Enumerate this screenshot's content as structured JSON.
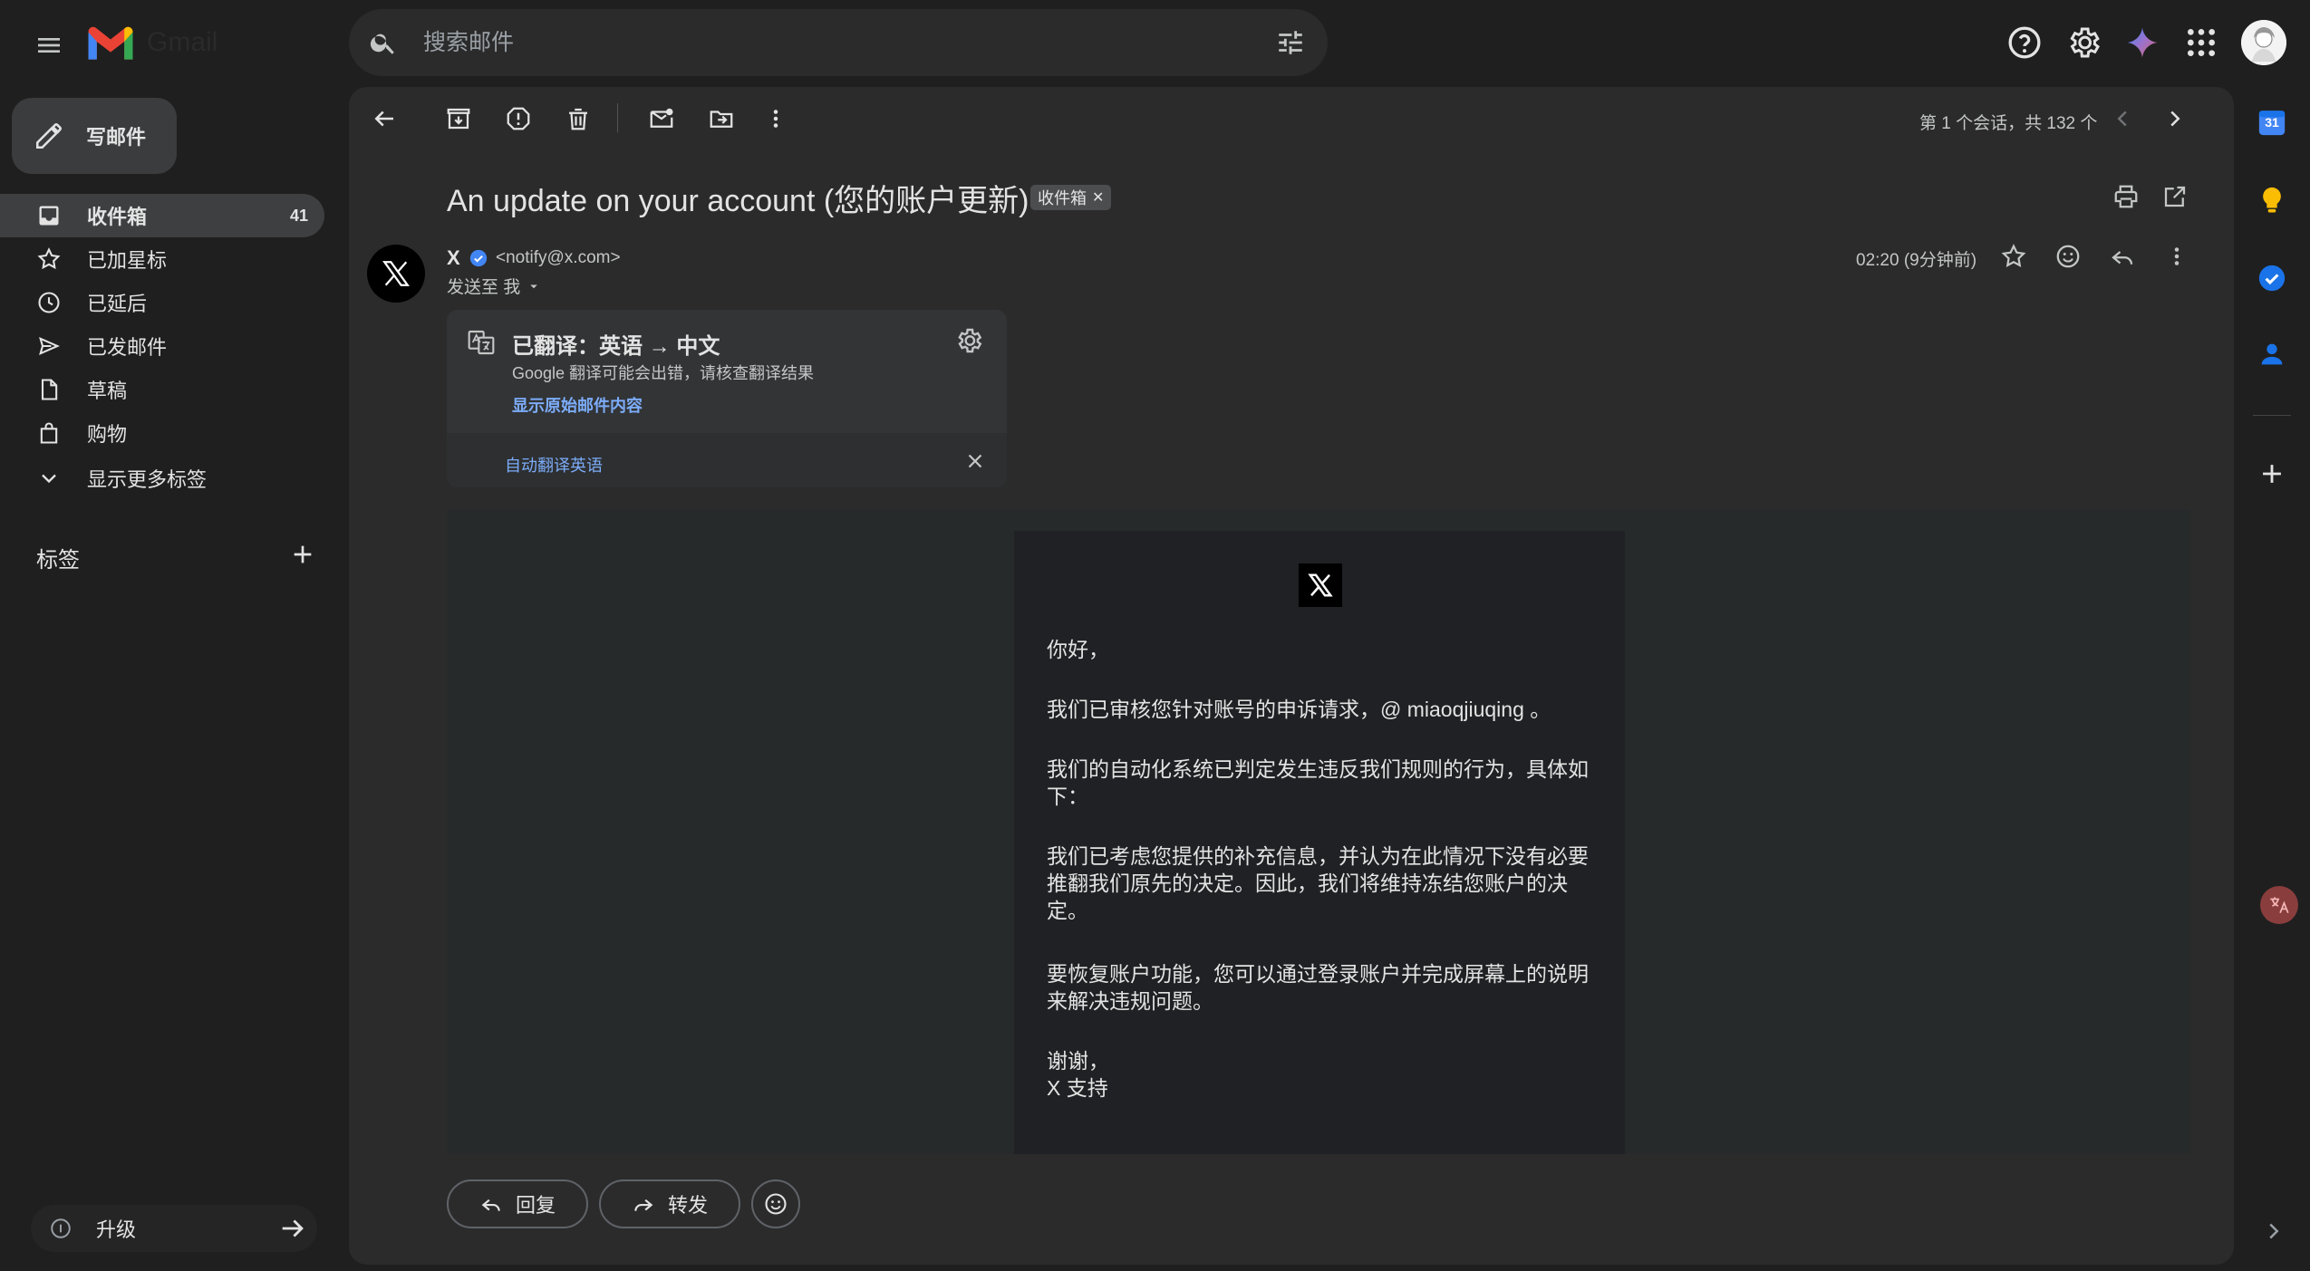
{
  "app": {
    "logo_text": "Gmail"
  },
  "search": {
    "placeholder": "搜索邮件"
  },
  "compose": {
    "label": "写邮件"
  },
  "sidebar": {
    "items": [
      {
        "label": "收件箱",
        "count": "41",
        "icon": "inbox-icon",
        "active": true
      },
      {
        "label": "已加星标",
        "icon": "star-icon"
      },
      {
        "label": "已延后",
        "icon": "clock-icon"
      },
      {
        "label": "已发邮件",
        "icon": "send-icon"
      },
      {
        "label": "草稿",
        "icon": "draft-icon"
      },
      {
        "label": "购物",
        "icon": "shopping-icon"
      },
      {
        "label": "显示更多标签",
        "icon": "chevron-down-icon"
      }
    ],
    "labels_title": "标签",
    "upgrade_label": "升级"
  },
  "toolbar": {
    "pagination": "第 1 个会话，共 132 个"
  },
  "email": {
    "subject": "An update on your account (您的账户更新)",
    "chip": "收件箱",
    "sender_name": "X",
    "sender_email": "<notify@x.com>",
    "recipient": "发送至 我",
    "time": "02:20 (9分钟前)",
    "translation": {
      "title": "已翻译：英语 → 中文",
      "subtitle": "Google 翻译可能会出错，请核查翻译结果",
      "show_original": "显示原始邮件内容",
      "auto_translate": "自动翻译英语"
    },
    "body": {
      "greeting": "你好，",
      "p1": "我们已审核您针对账号的申诉请求，@ miaoqjiuqing 。",
      "p2": "我们的自动化系统已判定发生违反我们规则的行为，具体如下：",
      "p3": "我们已考虑您提供的补充信息，并认为在此情况下没有必要推翻我们原先的决定。因此，我们将维持冻结您账户的决定。",
      "p4": "要恢复账户功能，您可以通过登录账户并完成屏幕上的说明来解决违规问题。",
      "sign1": "谢谢，",
      "sign2": "X 支持"
    }
  },
  "actions": {
    "reply": "回复",
    "forward": "转发"
  },
  "side_panel": {
    "calendar_day": "31"
  },
  "colors": {
    "background": "#1f1f1f",
    "panel": "#2b2b2b",
    "link": "#7cacf8",
    "gmail_red": "#ea4335"
  }
}
